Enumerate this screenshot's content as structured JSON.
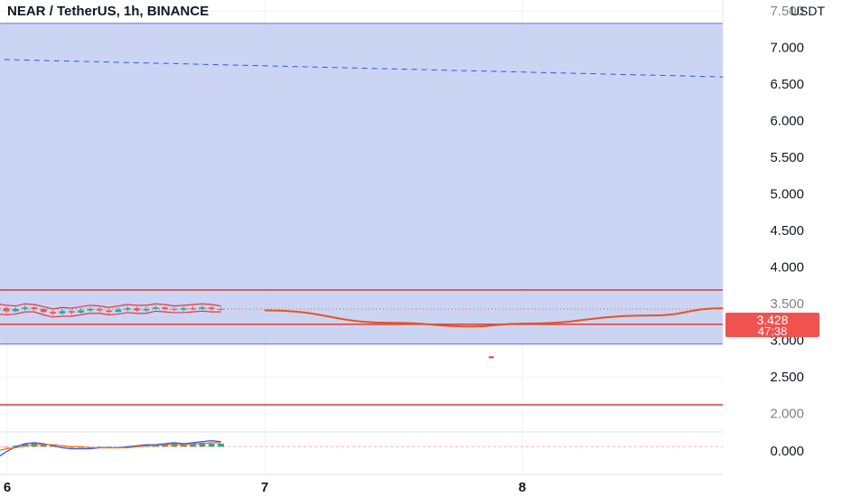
{
  "title": "NEAR / TetherUS, 1h, BINANCE",
  "chart_data": {
    "type": "candlestick",
    "title": "NEAR / TetherUS, 1h, BINANCE",
    "currency": "USDT",
    "y_ticks_visible": [
      "7.000",
      "6.500",
      "6.000",
      "5.500",
      "5.000",
      "4.500",
      "4.000",
      "3.000",
      "2.500",
      "0.000"
    ],
    "y_ticks_partially_hidden": [
      "7.500",
      "3.500",
      "2.000"
    ],
    "ylim": [
      1.75,
      7.65
    ],
    "x_ticks": [
      "6",
      "7",
      "8"
    ],
    "last_price": "3.428",
    "countdown": "47:38",
    "grid": true,
    "colors": {
      "up": "#26a69a",
      "down": "#ef5350",
      "zone_fill": "#c5d0f2",
      "zone_border": "#5b74d8",
      "support_line": "#e53935",
      "price_label_bg": "#f0524f",
      "macd_line": "#2962ff",
      "signal_line": "#ff6d00"
    },
    "drawings": {
      "blue_zone": {
        "top": 7.33,
        "bottom": 2.95
      },
      "blue_dashed_line": {
        "from": [
          5.95,
          6.84
        ],
        "to": [
          8.78,
          6.6
        ]
      },
      "red_box": {
        "top": 3.69,
        "bottom": 3.22
      },
      "red_horizontal_line": 2.12,
      "red_curve": [
        [
          7.0,
          3.41
        ],
        [
          7.5,
          3.24
        ],
        [
          7.8,
          3.19
        ],
        [
          8.0,
          3.23
        ],
        [
          8.5,
          3.34
        ],
        [
          8.78,
          3.44
        ]
      ]
    },
    "candles": [
      {
        "o": 3.42,
        "c": 3.44,
        "h": 3.48,
        "l": 3.38
      },
      {
        "o": 3.44,
        "c": 3.4,
        "h": 3.46,
        "l": 3.37
      },
      {
        "o": 3.4,
        "c": 3.43,
        "h": 3.45,
        "l": 3.38
      },
      {
        "o": 3.43,
        "c": 3.45,
        "h": 3.48,
        "l": 3.41
      },
      {
        "o": 3.45,
        "c": 3.43,
        "h": 3.47,
        "l": 3.41
      },
      {
        "o": 3.43,
        "c": 3.39,
        "h": 3.44,
        "l": 3.37
      },
      {
        "o": 3.39,
        "c": 3.37,
        "h": 3.41,
        "l": 3.34
      },
      {
        "o": 3.37,
        "c": 3.4,
        "h": 3.43,
        "l": 3.35
      },
      {
        "o": 3.4,
        "c": 3.38,
        "h": 3.42,
        "l": 3.35
      },
      {
        "o": 3.38,
        "c": 3.41,
        "h": 3.44,
        "l": 3.37
      },
      {
        "o": 3.41,
        "c": 3.43,
        "h": 3.46,
        "l": 3.39
      },
      {
        "o": 3.43,
        "c": 3.41,
        "h": 3.45,
        "l": 3.39
      },
      {
        "o": 3.41,
        "c": 3.39,
        "h": 3.43,
        "l": 3.37
      },
      {
        "o": 3.39,
        "c": 3.42,
        "h": 3.45,
        "l": 3.38
      },
      {
        "o": 3.42,
        "c": 3.44,
        "h": 3.47,
        "l": 3.4
      },
      {
        "o": 3.44,
        "c": 3.41,
        "h": 3.46,
        "l": 3.39
      },
      {
        "o": 3.41,
        "c": 3.43,
        "h": 3.46,
        "l": 3.39
      },
      {
        "o": 3.43,
        "c": 3.45,
        "h": 3.48,
        "l": 3.42
      },
      {
        "o": 3.45,
        "c": 3.43,
        "h": 3.47,
        "l": 3.41
      },
      {
        "o": 3.43,
        "c": 3.42,
        "h": 3.45,
        "l": 3.4
      },
      {
        "o": 3.42,
        "c": 3.44,
        "h": 3.46,
        "l": 3.4
      },
      {
        "o": 3.44,
        "c": 3.43,
        "h": 3.47,
        "l": 3.41
      },
      {
        "o": 3.43,
        "c": 3.45,
        "h": 3.48,
        "l": 3.42
      },
      {
        "o": 3.45,
        "c": 3.43,
        "h": 3.47,
        "l": 3.41
      },
      {
        "o": 3.43,
        "c": 3.428,
        "h": 3.45,
        "l": 3.41
      }
    ],
    "candle_x_range": [
      5.96,
      6.83
    ],
    "macd": {
      "ylim": [
        -0.014,
        0.012
      ],
      "histogram": [
        -0.002,
        -0.001,
        0.001,
        0.003,
        0.004,
        0.003,
        0.001,
        -0.001,
        -0.002,
        -0.002,
        -0.001,
        0.0,
        0.0,
        -0.001,
        0.0,
        0.001,
        0.002,
        0.002,
        0.003,
        0.004,
        0.003,
        0.004,
        0.004,
        0.003,
        0.003
      ],
      "macd_line": [
        -0.011,
        -0.005,
        0.0,
        0.003,
        0.004,
        0.003,
        0.001,
        -0.001,
        -0.002,
        -0.002,
        -0.002,
        -0.001,
        -0.001,
        -0.001,
        0.0,
        0.001,
        0.002,
        0.002,
        0.003,
        0.004,
        0.003,
        0.004,
        0.005,
        0.006,
        0.005
      ],
      "signal_line": [
        -0.004,
        -0.002,
        -0.001,
        0.001,
        0.002,
        0.002,
        0.002,
        0.001,
        0.0,
        0.0,
        -0.001,
        -0.001,
        -0.001,
        -0.001,
        -0.001,
        0.0,
        0.001,
        0.001,
        0.002,
        0.002,
        0.002,
        0.003,
        0.003,
        0.004,
        0.004
      ]
    }
  }
}
